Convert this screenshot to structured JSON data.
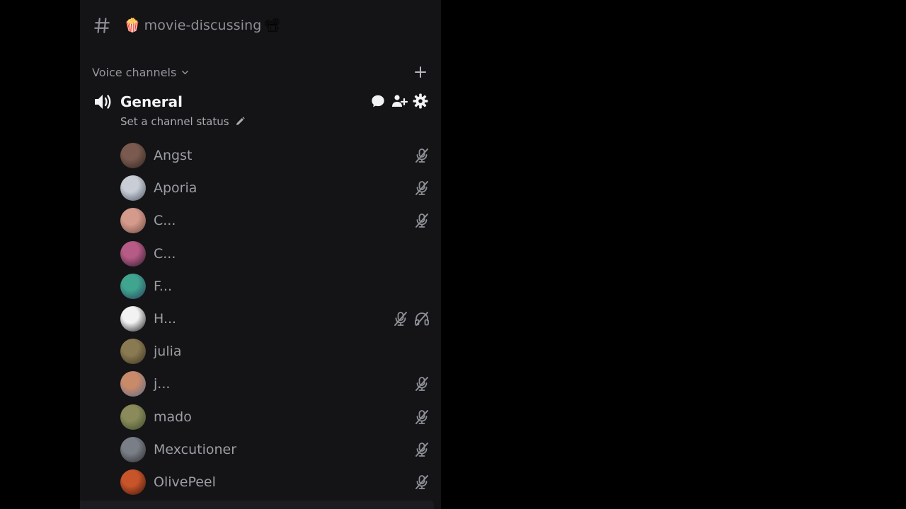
{
  "text_channel": {
    "name": "movie-discussing",
    "emoji_left": "🍿",
    "emoji_right": "📽"
  },
  "voice_category": {
    "label": "Voice channels"
  },
  "voice_channel": {
    "name": "General",
    "status_placeholder": "Set a channel status"
  },
  "members": [
    {
      "name": "Angst",
      "muted": true,
      "deafened": false,
      "avatar_colors": [
        "#7a5a4e",
        "#2f2420"
      ]
    },
    {
      "name": "Aporia",
      "muted": true,
      "deafened": false,
      "avatar_colors": [
        "#c9ced6",
        "#4b5362"
      ]
    },
    {
      "name": "C...",
      "muted": true,
      "deafened": false,
      "avatar_colors": [
        "#d49a8c",
        "#6e4a3f"
      ]
    },
    {
      "name": "C...",
      "muted": false,
      "deafened": false,
      "avatar_colors": [
        "#b65a86",
        "#2a1a2a"
      ]
    },
    {
      "name": "F...",
      "muted": false,
      "deafened": false,
      "avatar_colors": [
        "#3fa58f",
        "#2b3a5a"
      ]
    },
    {
      "name": "H...",
      "muted": true,
      "deafened": true,
      "avatar_colors": [
        "#f2f2f2",
        "#1a1a1a"
      ]
    },
    {
      "name": "julia",
      "muted": false,
      "deafened": false,
      "avatar_colors": [
        "#8a7a52",
        "#3a3222"
      ]
    },
    {
      "name": "j...",
      "muted": true,
      "deafened": false,
      "avatar_colors": [
        "#c98a6a",
        "#5a6a8a"
      ]
    },
    {
      "name": "mado",
      "muted": true,
      "deafened": false,
      "avatar_colors": [
        "#8a8a5a",
        "#3a4a2a"
      ]
    },
    {
      "name": "Mexcutioner",
      "muted": true,
      "deafened": false,
      "avatar_colors": [
        "#7a7e86",
        "#2a2c30"
      ]
    },
    {
      "name": "OlivePeel",
      "muted": true,
      "deafened": false,
      "avatar_colors": [
        "#c8552a",
        "#3a140a"
      ]
    }
  ],
  "colors": {
    "sidebar_bg": "#141416",
    "page_bg": "#000000",
    "muted_text": "#9c9ea4",
    "bright_text": "#f2f3f5",
    "icon_gray": "#8e9097"
  }
}
